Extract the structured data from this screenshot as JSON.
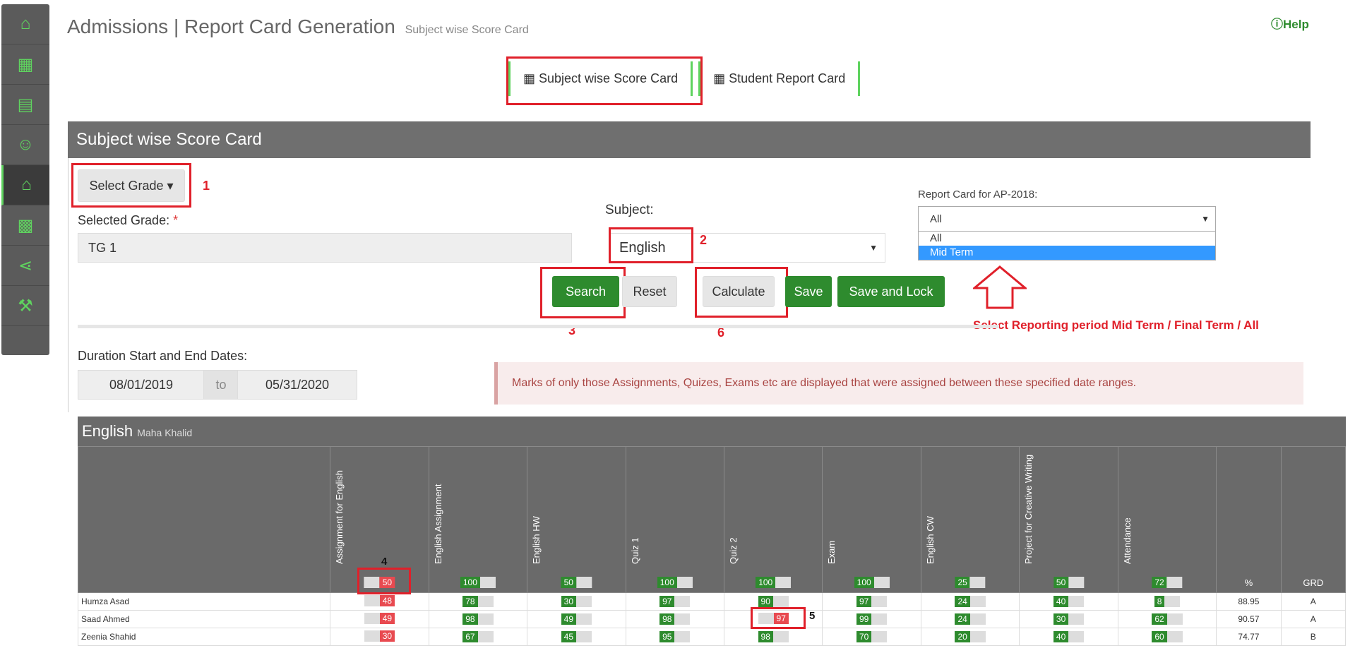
{
  "header": {
    "title": "Admissions | Report Card Generation",
    "subtitle": "Subject wise Score Card",
    "help": "Help"
  },
  "sidebar": {
    "items": [
      "home-icon",
      "building-icon",
      "calendar-icon",
      "user-icon",
      "graduation-cap-icon",
      "calculator-icon",
      "share-icon",
      "wrench-icon"
    ],
    "active": 4
  },
  "tabs": [
    {
      "label": "Subject wise Score Card"
    },
    {
      "label": "Student Report Card"
    }
  ],
  "panel": {
    "title": "Subject wise Score Card"
  },
  "form": {
    "select_grade": "Select Grade",
    "selected_grade_label": "Selected Grade:",
    "required": "*",
    "selected_grade_value": "TG 1",
    "subject_label": "Subject:",
    "subject_value": "English",
    "report_card_label": "Report Card for AP-2018:",
    "report_card_value": "All",
    "report_card_options": [
      "All",
      "Mid Term"
    ],
    "search": "Search",
    "reset": "Reset",
    "calculate": "Calculate",
    "save": "Save",
    "save_lock": "Save and Lock",
    "duration_label": "Duration Start and End Dates:",
    "start_date": "08/01/2019",
    "to": "to",
    "end_date": "05/31/2020",
    "alert": "Marks of only those Assignments, Quizes, Exams etc are displayed that were assigned between these specified date ranges."
  },
  "annotations": {
    "n1": "1",
    "n2": "2",
    "n3": "3",
    "n4": "4",
    "n5": "5",
    "n6": "6",
    "note": "Select Reporting period Mid Term / Final Term / All"
  },
  "table": {
    "subject": "English",
    "teacher": "Maha Khalid",
    "columns": [
      {
        "name": "Assignment for English",
        "max": "50",
        "color": "red"
      },
      {
        "name": "English Assignment",
        "max": "100",
        "color": "green"
      },
      {
        "name": "English HW",
        "max": "50",
        "color": "green"
      },
      {
        "name": "Quiz 1",
        "max": "100",
        "color": "green"
      },
      {
        "name": "Quiz 2",
        "max": "100",
        "color": "green"
      },
      {
        "name": "Exam",
        "max": "100",
        "color": "green"
      },
      {
        "name": "English CW",
        "max": "25",
        "color": "green"
      },
      {
        "name": "Project for Creative Writing",
        "max": "50",
        "color": "green"
      },
      {
        "name": "Attendance",
        "max": "72",
        "color": "green"
      }
    ],
    "pct_header": "%",
    "grd_header": "GRD",
    "rows": [
      {
        "name": "Humza Asad",
        "scores": [
          "48",
          "78",
          "30",
          "97",
          "90",
          "97",
          "24",
          "40",
          "8"
        ],
        "pct": "88.95",
        "grd": "A"
      },
      {
        "name": "Saad Ahmed",
        "scores": [
          "49",
          "98",
          "49",
          "98",
          "97",
          "99",
          "24",
          "30",
          "62"
        ],
        "pct": "90.57",
        "grd": "A"
      },
      {
        "name": "Zeenia Shahid",
        "scores": [
          "30",
          "67",
          "45",
          "95",
          "98",
          "70",
          "20",
          "40",
          "60"
        ],
        "pct": "74.77",
        "grd": "B"
      }
    ]
  }
}
